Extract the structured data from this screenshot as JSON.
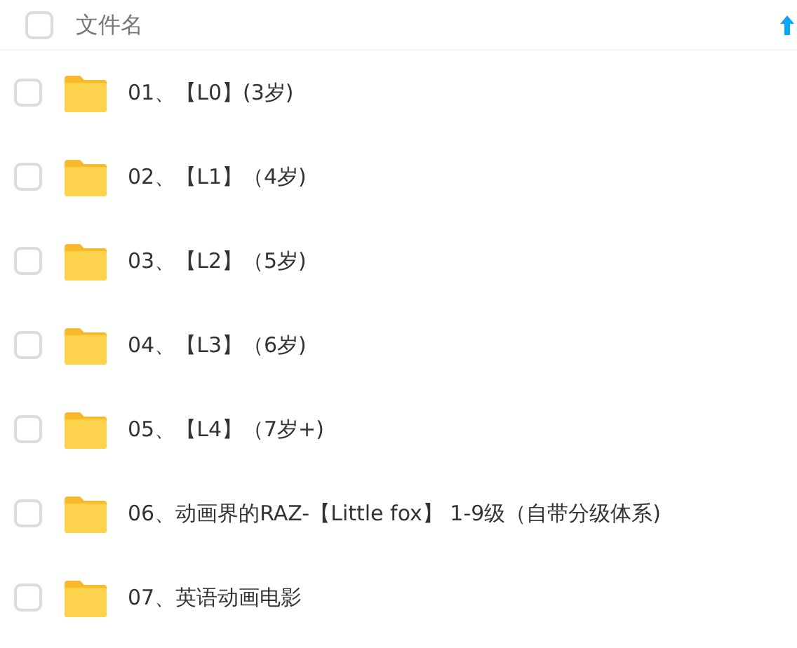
{
  "header": {
    "label": "文件名",
    "checked": false
  },
  "files": [
    {
      "name": "01、【L0】(3岁)",
      "checked": false
    },
    {
      "name": "02、【L1】（4岁)",
      "checked": false
    },
    {
      "name": "03、【L2】（5岁)",
      "checked": false
    },
    {
      "name": "04、【L3】（6岁)",
      "checked": false
    },
    {
      "name": "05、【L4】（7岁+)",
      "checked": false
    },
    {
      "name": "06、动画界的RAZ-【Little fox】 1-9级（自带分级体系)",
      "checked": false
    },
    {
      "name": "07、英语动画电影",
      "checked": false
    }
  ]
}
